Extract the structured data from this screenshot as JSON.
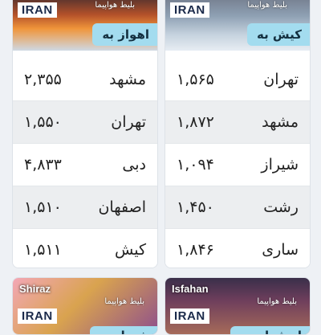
{
  "cards": {
    "kish": {
      "iran_tag": "IRAN",
      "ticket_text": "بلیط هواپیما",
      "destination": "کیش به",
      "routes": [
        {
          "city": "تهران",
          "price": "۱,۵۶۵"
        },
        {
          "city": "مشهد",
          "price": "۱,۸۷۲"
        },
        {
          "city": "شیراز",
          "price": "۱,۰۹۴"
        },
        {
          "city": "رشت",
          "price": "۱,۴۵۰"
        },
        {
          "city": "ساری",
          "price": "۱,۸۴۶"
        }
      ]
    },
    "ahvaz": {
      "iran_tag": "IRAN",
      "ticket_text": "بلیط هواپیما",
      "destination": "اهواز به",
      "routes": [
        {
          "city": "مشهد",
          "price": "۲,۳۵۵"
        },
        {
          "city": "تهران",
          "price": "۱,۵۵۰"
        },
        {
          "city": "دبی",
          "price": "۴,۸۳۳"
        },
        {
          "city": "اصفهان",
          "price": "۱,۵۱۰"
        },
        {
          "city": "کیش",
          "price": "۱,۵۱۱"
        }
      ]
    },
    "isfahan": {
      "latin_name": "Isfahan",
      "iran_tag": "IRAN",
      "ticket_text": "بلیط هواپیما",
      "destination": "اصفهان به"
    },
    "shiraz": {
      "latin_name": "Shiraz",
      "iran_tag": "IRAN",
      "ticket_text": "بلیط هواپیما",
      "destination": "شیراز به"
    }
  }
}
